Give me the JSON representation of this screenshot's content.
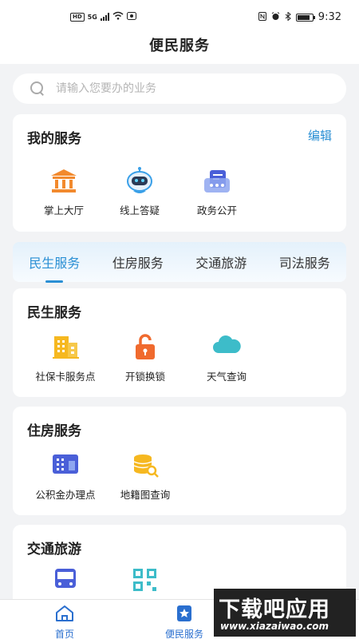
{
  "status_bar": {
    "hd": "HD",
    "network": "5G",
    "time": "9:32",
    "battery_level": 0.85
  },
  "header": {
    "title": "便民服务"
  },
  "search": {
    "placeholder": "请输入您要办的业务"
  },
  "my_services": {
    "title": "我的服务",
    "edit_label": "编辑",
    "items": [
      {
        "label": "掌上大厅",
        "icon": "bank-icon"
      },
      {
        "label": "线上答疑",
        "icon": "robot-icon"
      },
      {
        "label": "政务公开",
        "icon": "government-affairs-icon"
      }
    ]
  },
  "tabs": [
    {
      "label": "民生服务",
      "active": true
    },
    {
      "label": "住房服务",
      "active": false
    },
    {
      "label": "交通旅游",
      "active": false
    },
    {
      "label": "司法服务",
      "active": false
    }
  ],
  "sections": [
    {
      "title": "民生服务",
      "items": [
        {
          "label": "社保卡服务点",
          "icon": "building-icon"
        },
        {
          "label": "开锁换锁",
          "icon": "unlock-icon"
        },
        {
          "label": "天气查询",
          "icon": "cloud-icon"
        }
      ]
    },
    {
      "title": "住房服务",
      "items": [
        {
          "label": "公积金办理点",
          "icon": "office-building-icon"
        },
        {
          "label": "地籍图查询",
          "icon": "coins-search-icon"
        }
      ]
    },
    {
      "title": "交通旅游",
      "items": [
        {
          "label": "",
          "icon": "bus-icon"
        },
        {
          "label": "",
          "icon": "qr-code-icon"
        }
      ]
    }
  ],
  "bottom_nav": [
    {
      "label": "首页",
      "icon": "home-icon",
      "active": false
    },
    {
      "label": "便民服务",
      "icon": "star-bookmark-icon",
      "active": true
    }
  ],
  "watermark": {
    "main": "下载吧应用",
    "sub": "www.xiazaiwao.com"
  },
  "colors": {
    "accent": "#2a8fd4",
    "nav_active": "#2a6fcf",
    "orange": "#f28a2e",
    "teal": "#3dbcc9",
    "indigo": "#4a5fd8"
  }
}
